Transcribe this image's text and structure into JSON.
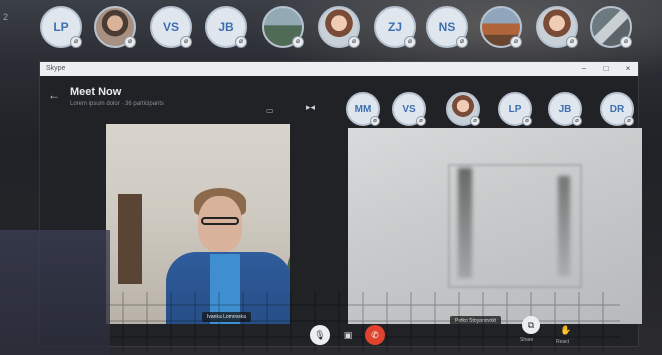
{
  "edge_number": "2",
  "top_participants": [
    {
      "initials": "LP",
      "photo": false
    },
    {
      "initials": "",
      "photo": true,
      "style": "b"
    },
    {
      "initials": "VS",
      "photo": false
    },
    {
      "initials": "JB",
      "photo": false
    },
    {
      "initials": "",
      "photo": true,
      "style": "d"
    },
    {
      "initials": "",
      "photo": true,
      "style": "e"
    },
    {
      "initials": "ZJ",
      "photo": false
    },
    {
      "initials": "NS",
      "photo": false
    },
    {
      "initials": "",
      "photo": true,
      "style": "c"
    },
    {
      "initials": "",
      "photo": true,
      "style": "e"
    },
    {
      "initials": "",
      "photo": true,
      "style": "f"
    }
  ],
  "window": {
    "title": "Skype",
    "minimize": "–",
    "maximize": "□",
    "close": "×"
  },
  "header": {
    "back_glyph": "←",
    "title": "Meet Now",
    "subtitle": "Lorem ipsum dolor · 36 participants"
  },
  "strip_participants": [
    {
      "initials": "MM",
      "photo": false
    },
    {
      "initials": "VS",
      "photo": false
    },
    {
      "initials": "",
      "photo": true
    },
    {
      "initials": "LP",
      "photo": false
    },
    {
      "initials": "JB",
      "photo": false
    },
    {
      "initials": "DR",
      "photo": false
    }
  ],
  "video_tiles": {
    "left_label": "Ivanka Lomovska",
    "right_label": "Petko Stoyanovski"
  },
  "controls": {
    "mic_icon": "🎙",
    "video_icon": "▣",
    "end_icon": "✆",
    "share_icon": "⧉",
    "react_icon": "✋",
    "share_label": "Share",
    "react_label": "React"
  },
  "colors": {
    "end_call": "#e0442e",
    "initials_text": "#3e6fb0",
    "avatar_bg": "#dfe6ee"
  }
}
